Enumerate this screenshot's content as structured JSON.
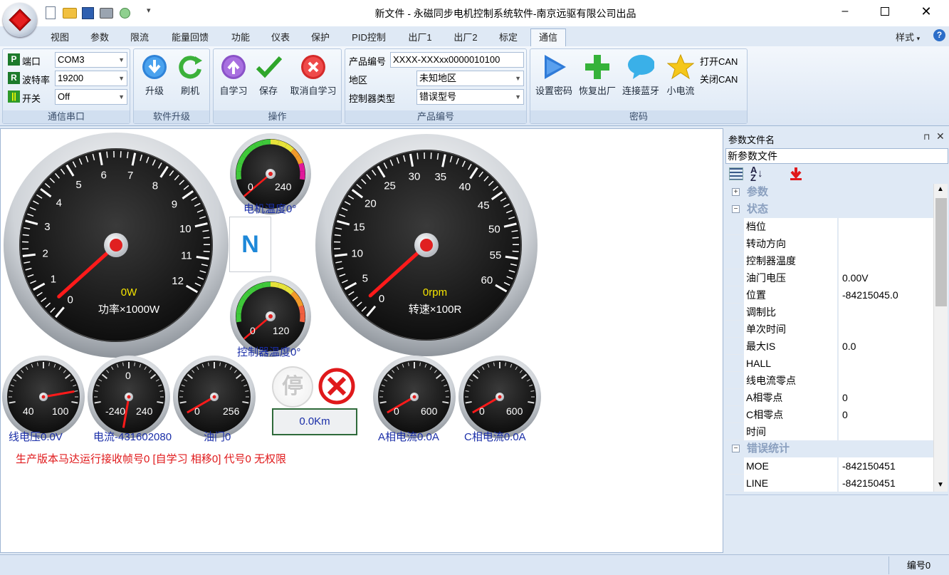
{
  "window": {
    "title": "新文件 - 永磁同步电机控制系统软件-南京远驱有限公司出品",
    "style_label": "样式"
  },
  "tabs": [
    "视图",
    "参数",
    "限流",
    "能量回馈",
    "功能",
    "仪表",
    "保护",
    "PID控制",
    "出厂1",
    "出厂2",
    "标定",
    "通信"
  ],
  "active_tab": "通信",
  "ribbon": {
    "serial": {
      "group_label": "通信串口",
      "port_label": "端口",
      "port_value": "COM3",
      "baud_label": "波特率",
      "baud_value": "19200",
      "switch_label": "开关",
      "switch_value": "Off"
    },
    "upgrade": {
      "group_label": "软件升级",
      "upgrade_label": "升级",
      "flash_label": "刷机"
    },
    "ops": {
      "group_label": "操作",
      "selflearn_label": "自学习",
      "save_label": "保存",
      "cancel_label": "取消自学习"
    },
    "product": {
      "group_label": "产品编号",
      "code_label": "产品编号",
      "code_value": "XXXX-XXXxx0000010100",
      "region_label": "地区",
      "region_value": "未知地区",
      "ctrl_label": "控制器类型",
      "ctrl_value": "错误型号"
    },
    "password": {
      "group_label": "密码",
      "set_pwd": "设置密码",
      "restore": "恢复出厂",
      "bt": "连接蓝牙",
      "small": "小电流",
      "open_can": "打开CAN",
      "close_can": "关闭CAN"
    }
  },
  "gauges": {
    "power": {
      "value": "0W",
      "label": "功率×1000W",
      "ticks": [
        "0",
        "1",
        "2",
        "3",
        "4",
        "5",
        "6",
        "7",
        "8",
        "9",
        "10",
        "11",
        "12"
      ],
      "level": 0
    },
    "speed": {
      "value": "0rpm",
      "label": "转速×100R",
      "ticks": [
        "0",
        "5",
        "10",
        "15",
        "20",
        "25",
        "30",
        "35",
        "40",
        "45",
        "50",
        "55",
        "60"
      ],
      "level": 0
    },
    "motor_temp": {
      "min": "0",
      "max": "240",
      "label": "电机温度0°"
    },
    "ctrl_temp": {
      "min": "0",
      "max": "120",
      "label": "控制器温度0°"
    },
    "gear": "N",
    "line_voltage": {
      "min": "40",
      "max": "100",
      "label": "线电压0.0V"
    },
    "current": {
      "min": "-240",
      "max": "240",
      "center": "0",
      "label": "电流-431602080"
    },
    "throttle": {
      "min": "0",
      "max": "256",
      "label": "油门0"
    },
    "a_current": {
      "min": "0",
      "max": "600",
      "label": "A相电流0.0A"
    },
    "c_current": {
      "min": "0",
      "max": "600",
      "label": "C相电流0.0A"
    }
  },
  "stop_label": "停",
  "odometer": "0.0Km",
  "status_message": "生产版本马达运行接收帧号0 [自学习 相移0] 代号0 无权限",
  "side_panel": {
    "title": "参数文件名",
    "file_name": "新参数文件",
    "categories": [
      {
        "name": "参数",
        "expanded": false,
        "rows": []
      },
      {
        "name": "状态",
        "expanded": true,
        "rows": [
          {
            "k": "档位",
            "v": ""
          },
          {
            "k": "转动方向",
            "v": ""
          },
          {
            "k": "控制器温度",
            "v": ""
          },
          {
            "k": "油门电压",
            "v": "0.00V"
          },
          {
            "k": "位置",
            "v": "-84215045.0"
          },
          {
            "k": "调制比",
            "v": ""
          },
          {
            "k": "单次时间",
            "v": ""
          },
          {
            "k": "最大IS",
            "v": "0.0"
          },
          {
            "k": "HALL",
            "v": ""
          },
          {
            "k": "线电流零点",
            "v": ""
          },
          {
            "k": "A相零点",
            "v": "0"
          },
          {
            "k": "C相零点",
            "v": "0"
          },
          {
            "k": "时间",
            "v": ""
          }
        ]
      },
      {
        "name": "错误统计",
        "expanded": true,
        "rows": [
          {
            "k": "MOE",
            "v": "-842150451"
          },
          {
            "k": "LINE",
            "v": "-842150451"
          }
        ]
      }
    ]
  },
  "statusbar": {
    "number_label": "编号0"
  }
}
